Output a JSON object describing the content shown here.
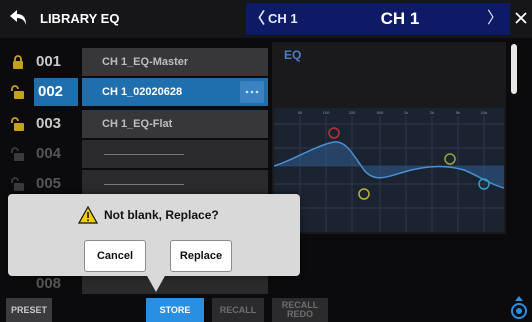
{
  "header": {
    "title": "LIBRARY EQ",
    "prev_channel": "CH 1",
    "channel": "CH 1",
    "next_symbol": "〉"
  },
  "library": {
    "rows": [
      {
        "number": "001",
        "name": "CH 1_EQ-Master",
        "locked": true
      },
      {
        "number": "002",
        "name": "CH 1_02020628",
        "locked": false,
        "selected": true
      },
      {
        "number": "003",
        "name": "CH 1_EQ-Flat",
        "locked": false
      },
      {
        "number": "004",
        "name": "",
        "empty": true
      },
      {
        "number": "005",
        "name": "",
        "empty": true
      },
      {
        "number": "008",
        "name": "",
        "empty": true
      }
    ],
    "more_label": "···"
  },
  "eq": {
    "title": "EQ",
    "freq_labels": [
      "50",
      "100",
      "200",
      "500",
      "1k",
      "2k",
      "5k",
      "10k"
    ],
    "colors": {
      "curve": "#3a77b8",
      "band_low": "#b8323a",
      "band_lowmid": "#b8b23a",
      "band_highmid": "#8fa83a",
      "band_high": "#2f9fc8"
    }
  },
  "dialog": {
    "message": "Not blank, Replace?",
    "cancel": "Cancel",
    "replace": "Replace"
  },
  "bottom": {
    "preset": "PRESET",
    "store": "STORE",
    "recall": "RECALL",
    "recall_redo_line1": "RECALL",
    "recall_redo_line2": "REDO"
  },
  "colors": {
    "accent": "#2a8fe0",
    "selected_row": "#1f6fae",
    "header_nav": "#0d1b66",
    "lock_icon": "#c8a020"
  }
}
